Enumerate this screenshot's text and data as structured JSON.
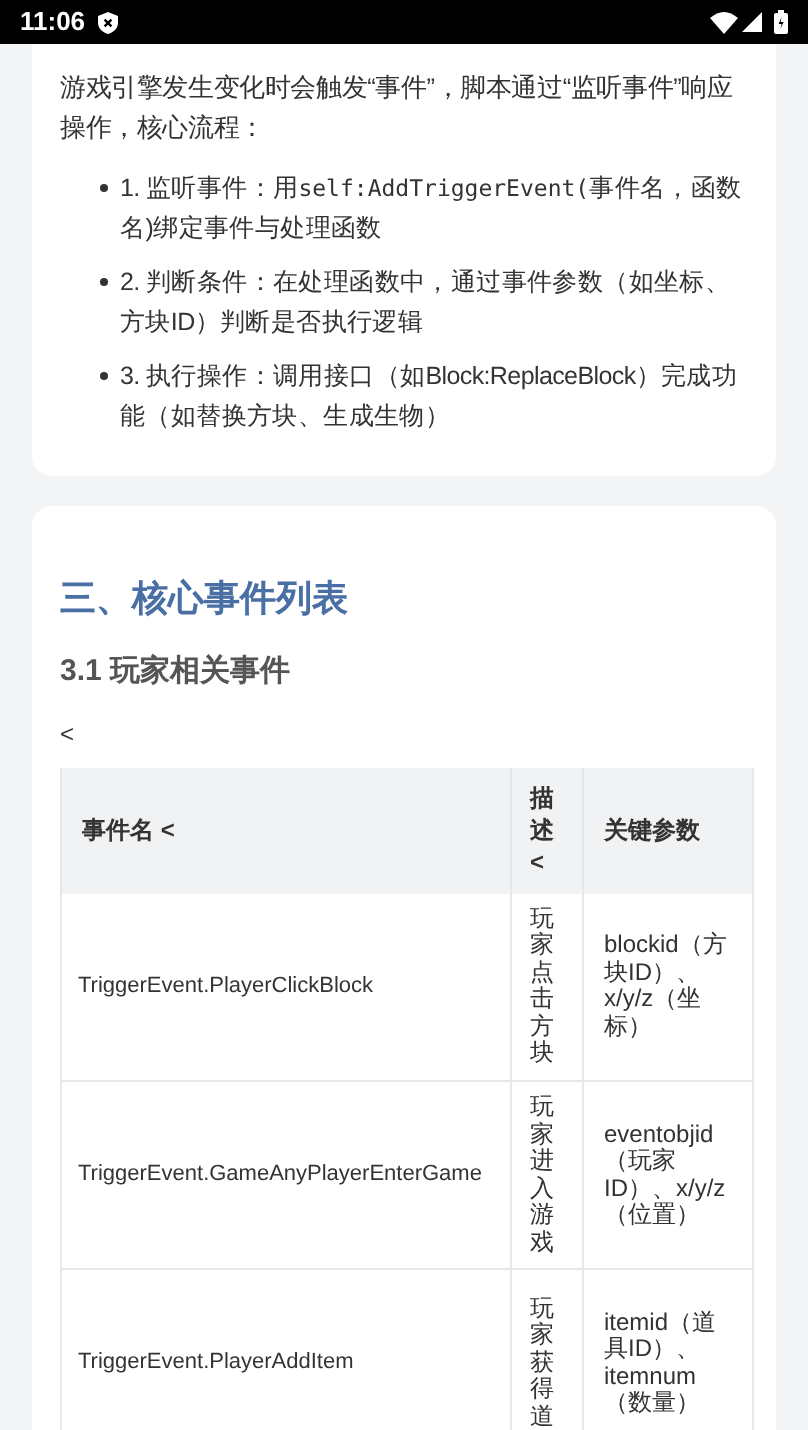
{
  "status_bar": {
    "time": "11:06"
  },
  "intro": {
    "paragraph": "游戏引擎发生变化时会触发“事件”，脚本通过“监听事件”响应操作，核心流程：",
    "steps": [
      {
        "before": "1. 监听事件：用",
        "code": "self:AddTriggerEvent(",
        "after": "事件名，函数名)绑定事件与处理函数"
      },
      {
        "before": "2. 判断条件：在处理函数中，通过事件参数（如坐标、方块ID）判断是否执行逻辑"
      },
      {
        "before": "3. 执行操作：调用接口（如Block:ReplaceBlock）完成功能（如替换方块、生成生物）"
      }
    ]
  },
  "section": {
    "heading": "三、核心事件列表",
    "subheading": "3.1 玩家相关事件",
    "stray_mark": "<",
    "table": {
      "columns": [
        "事件名 <",
        "描述 <",
        "关键参数"
      ],
      "rows": [
        [
          "TriggerEvent.PlayerClickBlock",
          "玩家点击方块",
          "blockid（方块ID）、x/y/z（坐标）"
        ],
        [
          "TriggerEvent.GameAnyPlayerEnterGame",
          "玩家进入游戏",
          "eventobjid（玩家ID）、x/y/z（位置）"
        ],
        [
          "TriggerEvent.PlayerAddItem",
          "玩家获得道",
          "itemid（道具ID）、itemnum（数量）"
        ]
      ]
    }
  }
}
